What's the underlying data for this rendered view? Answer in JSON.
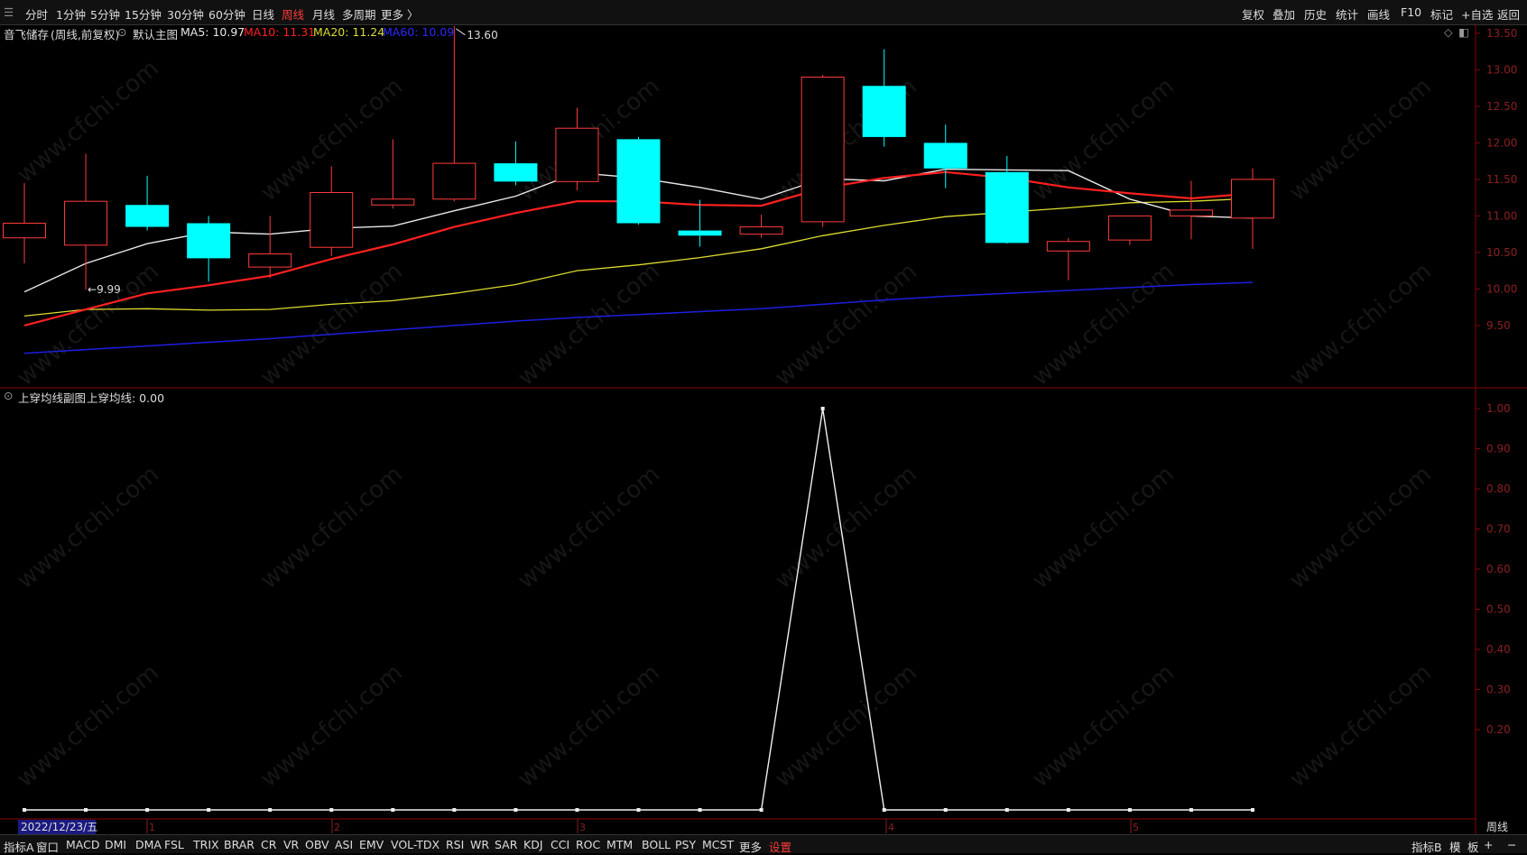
{
  "toolbar": {
    "periods": [
      "分时",
      "1分钟",
      "5分钟",
      "15分钟",
      "30分钟",
      "60分钟",
      "日线",
      "周线",
      "月线",
      "多周期",
      "更多 〉"
    ],
    "active_period": "周线",
    "right_tools": [
      "复权",
      "叠加",
      "历史",
      "统计",
      "画线",
      "F10",
      "标记",
      "+自选",
      "返回"
    ]
  },
  "main_info": {
    "stock": "音飞储存",
    "mode": "(周线,前复权)",
    "main_chart_label": "默认主图",
    "ma5": "MA5: 10.97",
    "ma10": "MA10: 11.31",
    "ma20": "MA20: 11.24",
    "ma60": "MA60: 10.09"
  },
  "sub_info": {
    "title": "上穿均线副图",
    "value": "上穿均线: 0.00"
  },
  "colors": {
    "up": "#ff3b3b",
    "down": "#00ffff",
    "ma5": "#e8e8e8",
    "ma10": "#ff2020",
    "ma20": "#dcdc30",
    "ma60": "#1e1ee0",
    "axis": "#8b0000"
  },
  "chart_data": [
    {
      "type": "candlestick",
      "title": "",
      "y_ticks": [
        "9.50",
        "10.00",
        "10.50",
        "11.00",
        "11.50",
        "12.00",
        "12.50",
        "13.00",
        "13.50"
      ],
      "ylim": [
        9.0,
        13.85
      ],
      "candles": [
        {
          "o": 10.7,
          "h": 11.45,
          "l": 10.35,
          "c": 10.9
        },
        {
          "o": 10.6,
          "h": 11.85,
          "l": 9.99,
          "c": 11.2
        },
        {
          "o": 11.15,
          "h": 11.55,
          "l": 10.8,
          "c": 10.85
        },
        {
          "o": 10.9,
          "h": 11.0,
          "l": 10.1,
          "c": 10.42
        },
        {
          "o": 10.3,
          "h": 11.0,
          "l": 10.15,
          "c": 10.48
        },
        {
          "o": 10.57,
          "h": 11.68,
          "l": 10.45,
          "c": 11.32
        },
        {
          "o": 11.15,
          "h": 12.05,
          "l": 11.1,
          "c": 11.23
        },
        {
          "o": 11.23,
          "h": 13.6,
          "l": 11.2,
          "c": 11.72
        },
        {
          "o": 11.72,
          "h": 12.02,
          "l": 11.42,
          "c": 11.47
        },
        {
          "o": 11.47,
          "h": 12.48,
          "l": 11.35,
          "c": 12.2
        },
        {
          "o": 12.05,
          "h": 12.08,
          "l": 10.88,
          "c": 10.9
        },
        {
          "o": 10.8,
          "h": 11.22,
          "l": 10.58,
          "c": 10.73
        },
        {
          "o": 10.75,
          "h": 11.02,
          "l": 10.7,
          "c": 10.85
        },
        {
          "o": 10.92,
          "h": 12.93,
          "l": 10.85,
          "c": 12.9
        },
        {
          "o": 12.78,
          "h": 13.28,
          "l": 11.95,
          "c": 12.08
        },
        {
          "o": 12.0,
          "h": 12.25,
          "l": 11.38,
          "c": 11.65
        },
        {
          "o": 11.6,
          "h": 11.82,
          "l": 10.62,
          "c": 10.63
        },
        {
          "o": 10.52,
          "h": 10.7,
          "l": 10.12,
          "c": 10.65
        },
        {
          "o": 10.67,
          "h": 11.0,
          "l": 10.6,
          "c": 11.0
        },
        {
          "o": 11.0,
          "h": 11.48,
          "l": 10.68,
          "c": 11.08
        },
        {
          "o": 10.97,
          "h": 11.65,
          "l": 10.55,
          "c": 11.5
        }
      ],
      "ma5": [
        9.96,
        10.35,
        10.62,
        10.78,
        10.75,
        10.83,
        10.86,
        11.07,
        11.27,
        11.59,
        11.52,
        11.39,
        11.23,
        11.51,
        11.48,
        11.64,
        11.63,
        11.62,
        11.23,
        11.0,
        10.97
      ],
      "ma10": [
        9.5,
        9.72,
        9.94,
        10.05,
        10.18,
        10.41,
        10.61,
        10.85,
        11.04,
        11.2,
        11.2,
        11.15,
        11.14,
        11.38,
        11.52,
        11.6,
        11.52,
        11.39,
        11.31,
        11.24,
        11.31
      ],
      "ma20": [
        9.63,
        9.72,
        9.73,
        9.71,
        9.72,
        9.79,
        9.84,
        9.94,
        10.06,
        10.25,
        10.33,
        10.43,
        10.55,
        10.73,
        10.87,
        10.99,
        11.05,
        11.11,
        11.18,
        11.2,
        11.24
      ],
      "ma60": [
        9.12,
        9.17,
        9.22,
        9.27,
        9.32,
        9.38,
        9.44,
        9.5,
        9.56,
        9.61,
        9.65,
        9.69,
        9.73,
        9.79,
        9.85,
        9.9,
        9.94,
        9.98,
        10.02,
        10.06,
        10.09
      ],
      "annotations": [
        {
          "label": "13.60"
        },
        {
          "label": "←9.99"
        }
      ]
    },
    {
      "type": "line",
      "title": "",
      "y_ticks": [
        "0.20",
        "0.30",
        "0.40",
        "0.50",
        "0.60",
        "0.70",
        "0.80",
        "0.90",
        "1.00"
      ],
      "ylim": [
        0.0,
        1.03
      ],
      "values": [
        0,
        0,
        0,
        0,
        0,
        0,
        0,
        0,
        0,
        0,
        0,
        0,
        0,
        1,
        0,
        0,
        0,
        0,
        0,
        0,
        0
      ]
    }
  ],
  "x_axis": {
    "date_label": "2022/12/23/五",
    "month_marks": [
      "1",
      "2",
      "3",
      "4",
      "5"
    ]
  },
  "bottom_tabs": [
    "指标A",
    "窗口",
    "MACD",
    "DMI",
    "DMA",
    "FSL",
    "TRIX",
    "BRAR",
    "CR",
    "VR",
    "OBV",
    "ASI",
    "EMV",
    "VOL-TDX",
    "RSI",
    "WR",
    "SAR",
    "KDJ",
    "CCI",
    "ROC",
    "MTM",
    "BOLL",
    "PSY",
    "MCST",
    "更多",
    "设置"
  ],
  "bottom_right": [
    "指标B",
    "模",
    "板",
    "+",
    "−"
  ],
  "period_label": "周线",
  "watermark": "www.cfchi.com"
}
